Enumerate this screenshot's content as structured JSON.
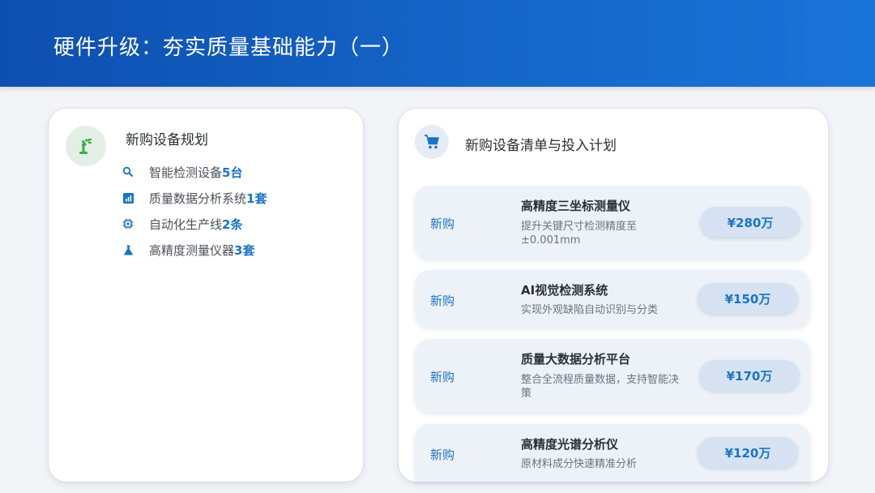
{
  "header": {
    "title": "硬件升级：夯实质量基础能力（一）"
  },
  "left_card": {
    "title": "新购设备规划",
    "icon": "robot-arm-icon",
    "items": [
      {
        "icon": "search-icon",
        "text": "智能检测设备",
        "count": "5台"
      },
      {
        "icon": "bar-chart-icon",
        "text": "质量数据分析系统",
        "count": "1套"
      },
      {
        "icon": "chip-icon",
        "text": "自动化生产线",
        "count": "2条"
      },
      {
        "icon": "flask-icon",
        "text": "高精度测量仪器",
        "count": "3套"
      }
    ]
  },
  "right_card": {
    "title": "新购设备清单与投入计划",
    "icon": "cart-icon",
    "rows": [
      {
        "tag": "新购",
        "name": "高精度三坐标测量仪",
        "desc": "提升关键尺寸检测精度至±0.001mm",
        "price": "¥280万"
      },
      {
        "tag": "新购",
        "name": "AI视觉检测系统",
        "desc": "实现外观缺陷自动识别与分类",
        "price": "¥150万"
      },
      {
        "tag": "新购",
        "name": "质量大数据分析平台",
        "desc": "整合全流程质量数据，支持智能决策",
        "price": "¥170万"
      },
      {
        "tag": "新购",
        "name": "高精度光谱分析仪",
        "desc": "原材料成分快速精准分析",
        "price": "¥120万"
      }
    ]
  },
  "colors": {
    "header": "#1565c8",
    "accent": "#1a73c9",
    "robot": "#3bab4a"
  }
}
